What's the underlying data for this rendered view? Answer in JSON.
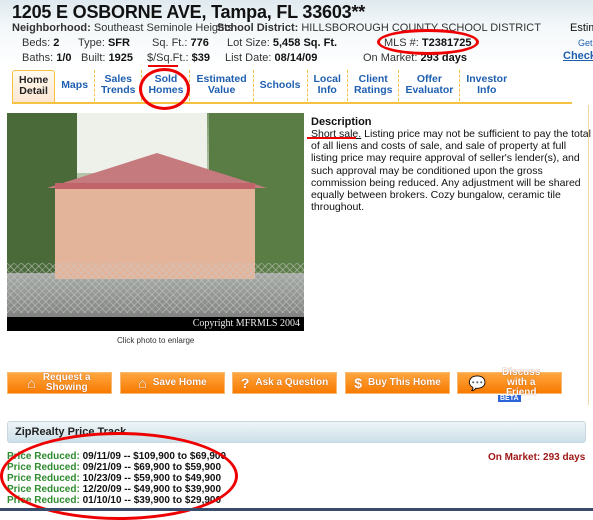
{
  "header": {
    "title": "1205 E OSBORNE AVE, Tampa, FL 33603**",
    "neighborhood_label": "Neighborhood:",
    "neighborhood": "Southeast Seminole Heights",
    "school_label": "School District:",
    "school": "HILLSBOROUGH COUNTY SCHOOL DISTRICT",
    "beds_label": "Beds:",
    "beds": "2",
    "type_label": "Type:",
    "type": "SFR",
    "sqft_label": "Sq. Ft.:",
    "sqft": "776",
    "lot_label": "Lot Size:",
    "lot": "5,458 Sq. Ft.",
    "mls_label": "MLS #:",
    "mls": "T2381725",
    "baths_label": "Baths:",
    "baths": "1/0",
    "built_label": "Built:",
    "built": "1925",
    "ppsf_label": "$/Sq.Ft.:",
    "ppsf": "$39",
    "listdate_label": "List Date:",
    "listdate": "08/14/09",
    "onmarket_label": "On Market:",
    "onmarket": "293 days",
    "estimate_text": "Estim",
    "get_text": "Get",
    "check_link": "Check"
  },
  "tabs": [
    {
      "line1": "Home",
      "line2": "Detail",
      "active": true
    },
    {
      "line1": "Maps",
      "line2": ""
    },
    {
      "line1": "Sales",
      "line2": "Trends"
    },
    {
      "line1": "Sold",
      "line2": "Homes"
    },
    {
      "line1": "Estimated",
      "line2": "Value"
    },
    {
      "line1": "Schools",
      "line2": ""
    },
    {
      "line1": "Local",
      "line2": "Info"
    },
    {
      "line1": "Client",
      "line2": "Ratings"
    },
    {
      "line1": "Offer",
      "line2": "Evaluator"
    },
    {
      "line1": "Investor",
      "line2": "Info"
    }
  ],
  "photo": {
    "copyright": "Copyright MFRMLS 2004",
    "caption": "Click photo to enlarge"
  },
  "description": {
    "heading": "Description",
    "lead": "Short sale.",
    "body": " Listing price may not be sufficient to pay the total of all liens and costs of sale, and sale of property at full listing price may require approval of seller's lender(s), and such approval may be conditioned upon the gross commission being reduced. Any adjustment will be shared equally between brokers. Cozy bungalow, ceramic tile throughout."
  },
  "actions": [
    {
      "label": "Request a Showing",
      "icon": "house-arrow-icon"
    },
    {
      "label": "Save Home",
      "icon": "house-icon"
    },
    {
      "label": "Ask a Question",
      "icon": "question-icon"
    },
    {
      "label": "Buy This Home",
      "icon": "dollar-icon"
    },
    {
      "label": "Discuss with a Friend",
      "icon": "chat-icon"
    }
  ],
  "beta_badge": "BETA",
  "price_track": {
    "title": "ZipRealty Price Track",
    "on_market": "On Market:  293 days",
    "entries": [
      {
        "label": "Price Reduced:",
        "text": "09/11/09 -- $109,900 to $69,900"
      },
      {
        "label": "Price Reduced:",
        "text": "09/21/09 -- $69,900 to $59,900"
      },
      {
        "label": "Price Reduced:",
        "text": "10/23/09 -- $59,900 to $49,900"
      },
      {
        "label": "Price Reduced:",
        "text": "12/20/09 -- $49,900 to $39,900"
      },
      {
        "label": "Price Reduced:",
        "text": "01/10/10 -- $39,900 to $29,900"
      }
    ]
  },
  "colors": {
    "accent_orange": "#f77a00",
    "link_blue": "#1f5fb0",
    "price_green": "#2e8b2e",
    "on_market_red": "#a01818",
    "annotation_red": "#e00000"
  }
}
